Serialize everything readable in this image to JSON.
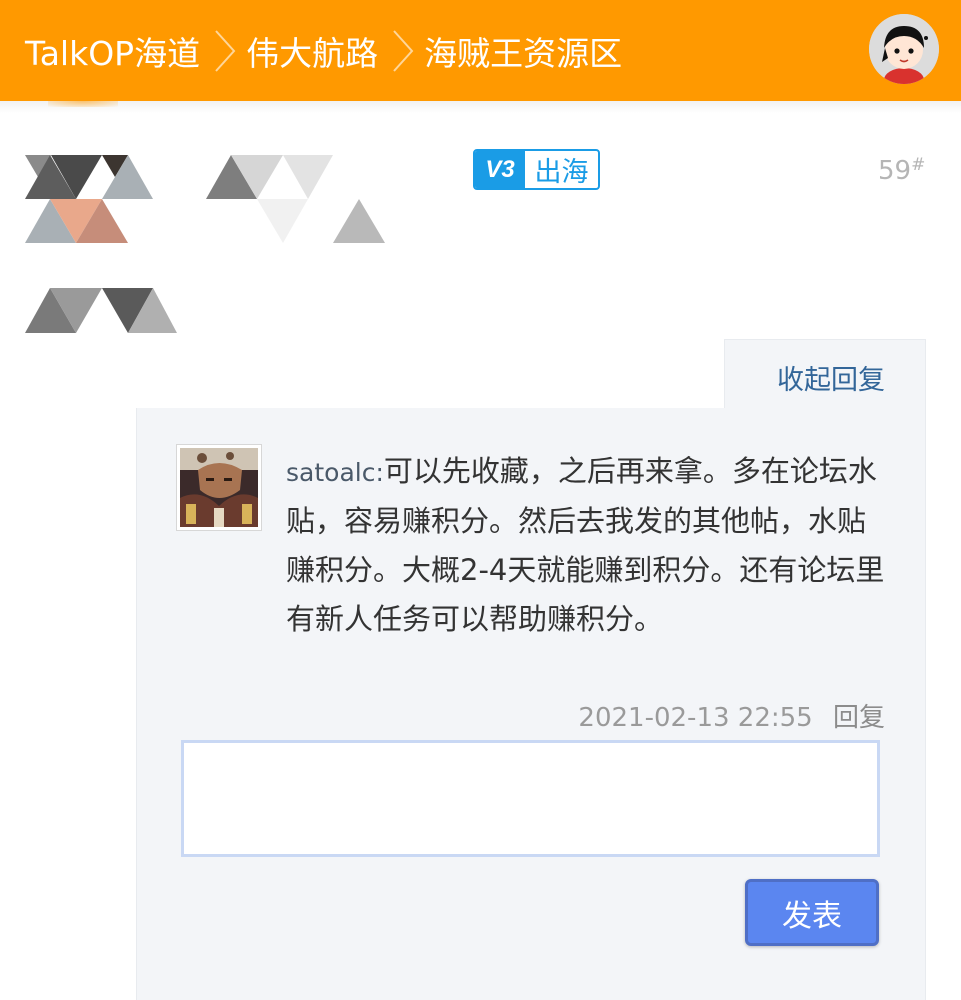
{
  "header": {
    "breadcrumbs": [
      {
        "label": "TalkOP海道"
      },
      {
        "label": "伟大航路"
      },
      {
        "label": "海贼王资源区"
      }
    ],
    "avatar_icon": "user-avatar-icon",
    "background_color": "#ff9900"
  },
  "post": {
    "badge": {
      "version": "V3",
      "label": "出海"
    },
    "floor_number": "59",
    "floor_mark": "#"
  },
  "replies": {
    "collapse_label": "收起回复",
    "items": [
      {
        "user": "satoalc:",
        "text": "可以先收藏，之后再来拿。多在论坛水贴，容易赚积分。然后去我发的其他帖，水贴赚积分。大概2-4天就能赚到积分。还有论坛里有新人任务可以帮助赚积分。",
        "timestamp": "2021-02-13 22:55",
        "reply_label": "回复"
      }
    ],
    "input_value": "",
    "submit_label": "发表"
  },
  "colors": {
    "accent": "#ff9900",
    "link": "#336699",
    "badge": "#1a9ce6",
    "button": "#5b86f0"
  }
}
